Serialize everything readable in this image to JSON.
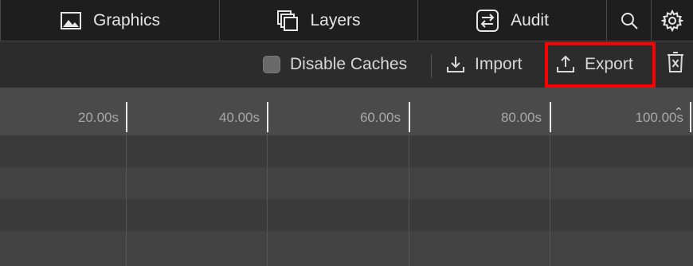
{
  "tabs": {
    "graphics": {
      "label": "Graphics",
      "icon": "image-icon"
    },
    "layers": {
      "label": "Layers",
      "icon": "layers-icon"
    },
    "audit": {
      "label": "Audit",
      "icon": "swap-arrows-icon"
    },
    "search": {
      "icon": "search-icon"
    },
    "settings": {
      "icon": "gear-icon"
    }
  },
  "toolbar": {
    "disable_caches_label": "Disable Caches",
    "disable_caches_checked": false,
    "import_label": "Import",
    "export_label": "Export",
    "trash_icon": "trash-icon"
  },
  "timeline": {
    "ticks": [
      "20.00s",
      "40.00s",
      "60.00s",
      "80.00s",
      "100.00s"
    ]
  },
  "colors": {
    "highlight": "#ff0000",
    "tabbar_bg": "#1e1e1e",
    "toolbar_bg": "#2c2c2c"
  }
}
